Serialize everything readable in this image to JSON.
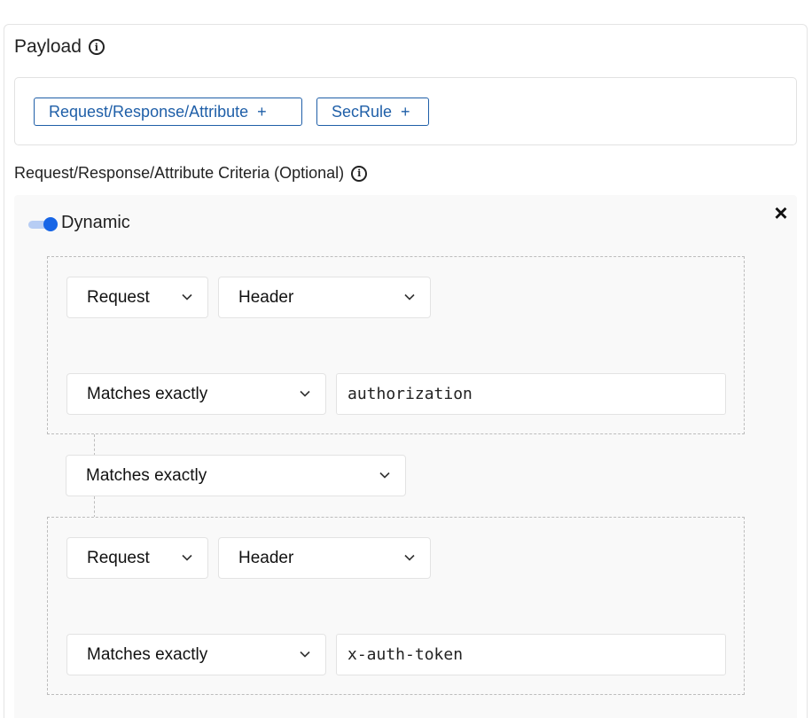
{
  "payload": {
    "title": "Payload",
    "chips": [
      {
        "label": "Request/Response/Attribute",
        "icon": "+"
      },
      {
        "label": "SecRule",
        "icon": "+"
      }
    ]
  },
  "criteria": {
    "title": "Request/Response/Attribute Criteria (Optional)",
    "toggle_label": "Dynamic",
    "close_icon": "×",
    "groups": [
      {
        "source": "Request",
        "field": "Header",
        "operator": "Matches exactly",
        "value": "authorization"
      },
      {
        "source": "Request",
        "field": "Header",
        "operator": "Matches exactly",
        "value": "x-auth-token"
      }
    ],
    "join_operator": "Matches exactly"
  },
  "colors": {
    "accent": "#1765e6",
    "chip_border": "#1f5fa8"
  }
}
